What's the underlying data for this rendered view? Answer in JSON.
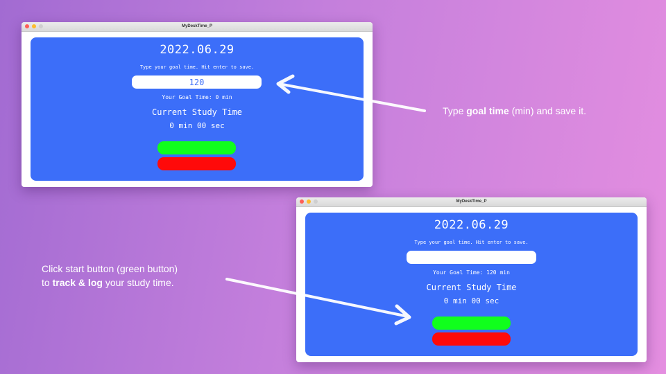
{
  "window_top": {
    "title": "MyDeskTime_P",
    "date": "2022.06.29",
    "prompt": "Type your goal time. Hit enter to save.",
    "goal_input_value": "120",
    "goal_label": "Your Goal Time:",
    "goal_value": "0",
    "goal_unit": "min",
    "study_title": "Current Study Time",
    "study_time": "0 min 00 sec"
  },
  "window_bottom": {
    "title": "MyDeskTime_P",
    "date": "2022.06.29",
    "prompt": "Type your goal time. Hit enter to save.",
    "goal_input_value": "",
    "goal_label": "Your Goal Time:",
    "goal_value": "120",
    "goal_unit": "min",
    "study_title": "Current Study Time",
    "study_time": "0 min 00 sec"
  },
  "caption_goal": {
    "pre": "Type ",
    "bold": "goal time",
    "post": " (min) and save it."
  },
  "caption_start": {
    "line1": "Click start button (green button)",
    "pre": "to ",
    "bold": "track & log",
    "post": " your study time."
  },
  "colors": {
    "panel": "#3c6ef9",
    "start_button": "#10ff1c",
    "stop_button": "#ff0a0a"
  }
}
